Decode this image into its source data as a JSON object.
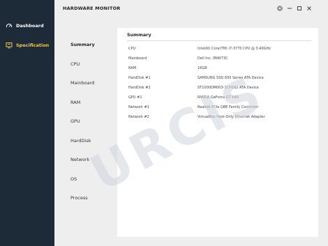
{
  "sidebar": {
    "items": [
      {
        "label": "Dashboard",
        "icon": "dashboard-gauge-icon"
      },
      {
        "label": "Specification",
        "icon": "monitor-spec-icon"
      }
    ]
  },
  "window": {
    "title": "HARDWARE MONITOR",
    "settings_icon": "gear-icon",
    "minimize_icon": "minimize-icon",
    "maximize_icon": "maximize-icon",
    "close_icon": "close-icon"
  },
  "sections": [
    "Summary",
    "CPU",
    "Mainboard",
    "RAM",
    "GPU",
    "HardDisk",
    "Network",
    "OS",
    "Process"
  ],
  "summary": {
    "title": "Summary",
    "rows": [
      {
        "key": "CPU",
        "value": "Intel(R) Core(TM) i7-3770 CPU @ 3.40GHz"
      },
      {
        "key": "Mainboard",
        "value": "Dell Inc. 0NW73C"
      },
      {
        "key": "RAM",
        "value": "16GB"
      },
      {
        "key": "HardDisk #1",
        "value": "SAMSUNG SSD 830 Series ATA Device"
      },
      {
        "key": "HardDisk #2",
        "value": "ST1000DM003-1CH162 ATA Device"
      },
      {
        "key": "GPU #1",
        "value": "NVIDIA GeForce GT 640"
      },
      {
        "key": "Network #1",
        "value": "Realtek PCIe GBE Family Controller"
      },
      {
        "key": "Network #2",
        "value": "VirtualBox Host-Only Ethernet Adapter"
      }
    ]
  },
  "watermark": "URCIS",
  "colors": {
    "sidebar_bg": "#1d2a38",
    "active_nav": "#f2c94c"
  }
}
